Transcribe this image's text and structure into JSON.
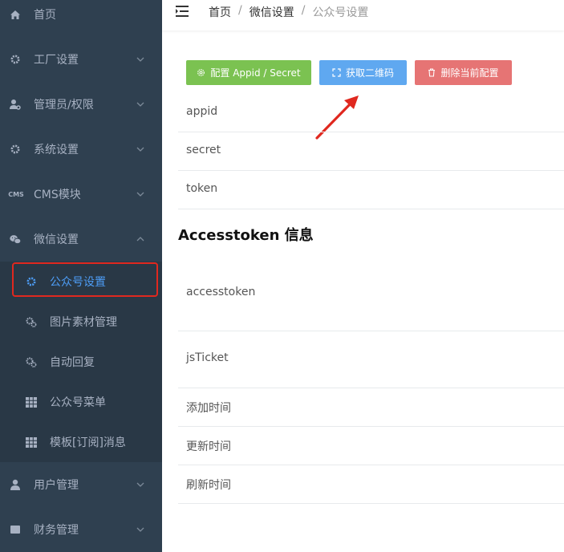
{
  "sidebar": {
    "items": [
      {
        "label": "首页",
        "icon": "home-icon"
      },
      {
        "label": "工厂设置",
        "icon": "gear-icon"
      },
      {
        "label": "管理员/权限",
        "icon": "admin-icon"
      },
      {
        "label": "系统设置",
        "icon": "gear-icon"
      },
      {
        "label": "CMS模块",
        "icon": "cms-icon",
        "icon_text": "CMS"
      },
      {
        "label": "微信设置",
        "icon": "wechat-icon"
      },
      {
        "label": "用户管理",
        "icon": "user-icon"
      },
      {
        "label": "财务管理",
        "icon": "finance-icon"
      }
    ],
    "subitems": [
      {
        "label": "公众号设置",
        "icon": "gear-icon",
        "active": true
      },
      {
        "label": "图片素材管理",
        "icon": "gears-icon"
      },
      {
        "label": "自动回复",
        "icon": "gears-icon"
      },
      {
        "label": "公众号菜单",
        "icon": "grid-icon"
      },
      {
        "label": "模板[订阅]消息",
        "icon": "grid-icon"
      }
    ]
  },
  "breadcrumb": {
    "items": [
      "首页",
      "微信设置",
      "公众号设置"
    ],
    "separator": "/"
  },
  "buttons": {
    "config_label": "配置 Appid / Secret",
    "qrcode_label": "获取二维码",
    "delete_label": "删除当前配置"
  },
  "fields": {
    "appid": "appid",
    "secret": "secret",
    "token": "token"
  },
  "section": {
    "title": "Accesstoken 信息"
  },
  "info_fields": {
    "accesstoken": "accesstoken",
    "jsticket": "jsTicket",
    "add_time": "添加时间",
    "update_time": "更新时间",
    "refresh_time": "刷新时间"
  },
  "colors": {
    "sidebar_bg": "#2f4050",
    "submenu_bg": "#293846",
    "active_text": "#4d9df6",
    "green": "#7bc251",
    "blue": "#5fa8f0",
    "red": "#e67474",
    "highlight": "#e0281f"
  }
}
